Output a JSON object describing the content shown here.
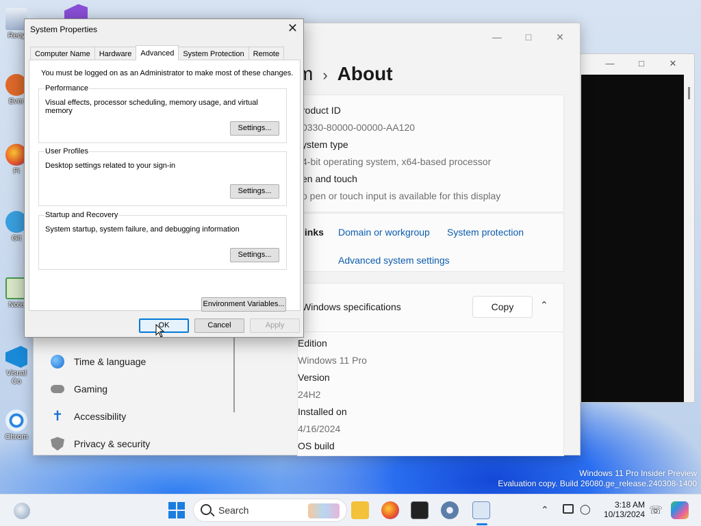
{
  "desktop": {
    "icons": [
      {
        "label": "Recy",
        "color": "#5b8bd8"
      },
      {
        "label": "Ever",
        "color": "#e06a2a"
      },
      {
        "label": "Fi",
        "color": "#f07a2a"
      },
      {
        "label": "Git",
        "color": "#3aa0e0"
      },
      {
        "label": "Note",
        "color": "#4a9a4a"
      },
      {
        "label": "Visual",
        "label2": "Co",
        "color": "#1a8ad8"
      },
      {
        "label": "Chrom",
        "color": "#2a86e0"
      }
    ]
  },
  "settings": {
    "title_partial": "m",
    "page_title": "About",
    "product_id_label": "roduct ID",
    "product_id_value": "0330-80000-00000-AA120",
    "system_type_label": "ystem type",
    "system_type_value": "4-bit operating system, x64-based processor",
    "pen_touch_label": "en and touch",
    "pen_touch_value": "o pen or touch input is available for this display",
    "links_label": "links",
    "link_domain": "Domain or workgroup",
    "link_protection": "System protection",
    "link_advanced": "Advanced system settings",
    "specs_title": "Windows specifications",
    "copy_label": "Copy",
    "edition_label": "Edition",
    "edition_value": "Windows 11 Pro",
    "version_label": "Version",
    "version_value": "24H2",
    "installed_label": "Installed on",
    "installed_value": "4/16/2024",
    "osbuild_label": "OS build",
    "nav": [
      {
        "label": "Time & language",
        "icon": "globe-clock-icon"
      },
      {
        "label": "Gaming",
        "icon": "gamepad-icon"
      },
      {
        "label": "Accessibility",
        "icon": "accessibility-icon"
      },
      {
        "label": "Privacy & security",
        "icon": "shield-icon"
      }
    ]
  },
  "dialog": {
    "title": "System Properties",
    "tabs": [
      "Computer Name",
      "Hardware",
      "Advanced",
      "System Protection",
      "Remote"
    ],
    "active_tab": "Advanced",
    "admin_note": "You must be logged on as an Administrator to make most of these changes.",
    "groups": [
      {
        "title": "Performance",
        "desc": "Visual effects, processor scheduling, memory usage, and virtual memory",
        "button": "Settings..."
      },
      {
        "title": "User Profiles",
        "desc": "Desktop settings related to your sign-in",
        "button": "Settings..."
      },
      {
        "title": "Startup and Recovery",
        "desc": "System startup, system failure, and debugging information",
        "button": "Settings..."
      }
    ],
    "env_button": "Environment Variables...",
    "ok": "OK",
    "cancel": "Cancel",
    "apply": "Apply"
  },
  "taskbar": {
    "search_label": "Search",
    "time": "3:18 AM",
    "date": "10/13/2024"
  },
  "watermark": {
    "line1": "Windows 11 Pro Insider Preview",
    "line2": "Evaluation copy. Build 26080.ge_release.240308-1400"
  }
}
